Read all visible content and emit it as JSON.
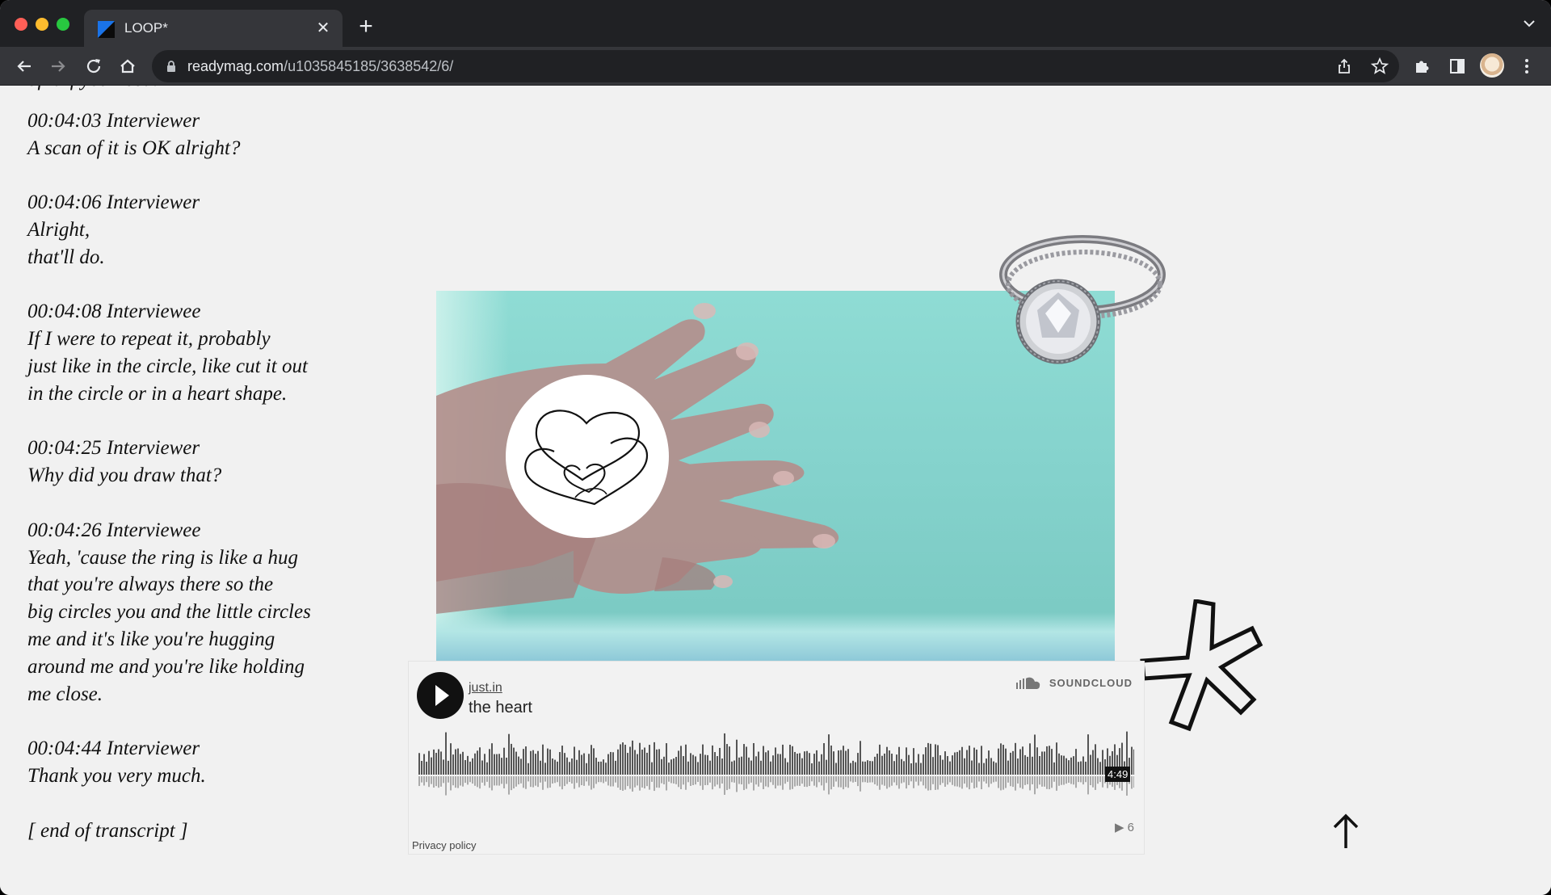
{
  "browser": {
    "tab_title": "LOOP*",
    "url_host": "readymag.com",
    "url_path": "/u1035845185/3638542/6/"
  },
  "transcript": {
    "entries": [
      {
        "stamp": "00:04:03 Interviewer",
        "lines": [
          "A scan of it is OK alright?"
        ]
      },
      {
        "stamp": "00:04:06 Interviewer",
        "lines": [
          "Alright,",
          "that'll do."
        ]
      },
      {
        "stamp": "00:04:08 Interviewee",
        "lines": [
          "If I were to repeat it, probably",
          "just like in the circle, like cut it out",
          "in the circle or in a heart shape."
        ]
      },
      {
        "stamp": "00:04:25 Interviewer",
        "lines": [
          "Why did you draw that?"
        ]
      },
      {
        "stamp": "00:04:26 Interviewee",
        "lines": [
          "Yeah, 'cause the ring is like a hug",
          "that you're always there so the",
          "big circles you and the little circles",
          "me and it's like you're hugging",
          "around me and you're like holding",
          "me close."
        ]
      },
      {
        "stamp": "00:04:44 Interviewer",
        "lines": [
          "Thank you very much."
        ]
      }
    ],
    "closing": "[ end of transcript ]",
    "clipped_top_line": "of it if you need."
  },
  "soundcloud": {
    "user": "just.in",
    "track": "the heart",
    "brand": "SOUNDCLOUD",
    "duration": "4:49",
    "plays": "▶ 6",
    "privacy": "Privacy policy",
    "waveform_color": "#555555"
  },
  "colors": {
    "page_bg": "#f1f1f1",
    "video_teal": "#8fdcd4",
    "chrome_dark": "#202124"
  }
}
